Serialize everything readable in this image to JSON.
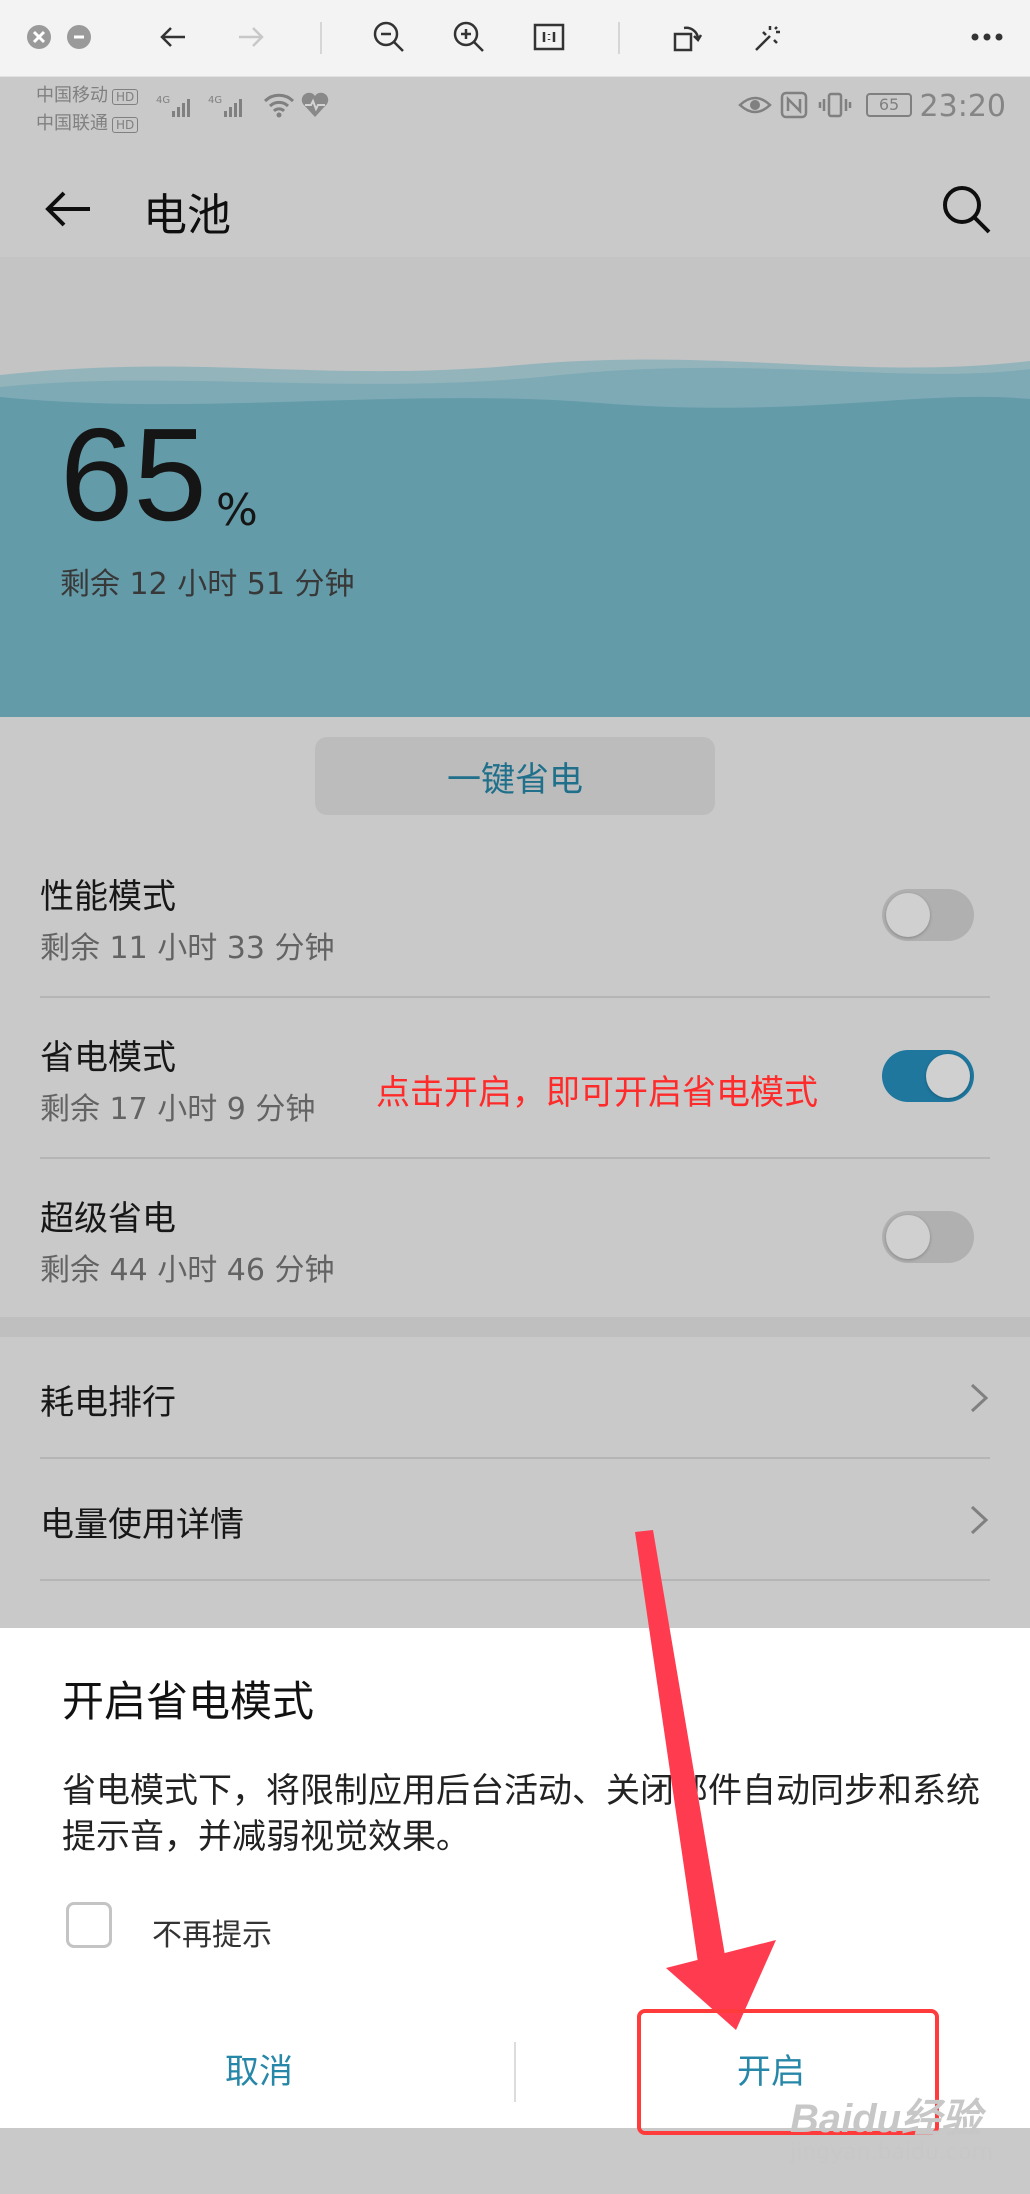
{
  "viewer": {
    "icons": [
      "close-icon",
      "minimize-icon",
      "back-arrow-icon",
      "forward-arrow-icon",
      "zoom-out-icon",
      "zoom-in-icon",
      "actual-size-icon",
      "rotate-icon",
      "magic-wand-icon",
      "more-icon"
    ]
  },
  "status_bar": {
    "carrier_1": "中国移动",
    "carrier_2": "中国联通",
    "hd_badge": "HD",
    "signal_label": "4G",
    "battery_level": "65",
    "time": "23:20"
  },
  "app_bar": {
    "title": "电池"
  },
  "battery": {
    "percent": "65",
    "percent_sign": "%",
    "remaining": "剩余 12 小时 51 分钟",
    "wave_color": "#6fb6c8"
  },
  "one_click_label": "一键省电",
  "modes": [
    {
      "title": "性能模式",
      "remaining": "剩余 11 小时 33 分钟",
      "enabled": false
    },
    {
      "title": "省电模式",
      "remaining": "剩余 17 小时 9 分钟",
      "enabled": true
    },
    {
      "title": "超级省电",
      "remaining": "剩余 44 小时 46 分钟",
      "enabled": false
    }
  ],
  "links": [
    {
      "label": "耗电排行"
    },
    {
      "label": "电量使用详情"
    }
  ],
  "dialog": {
    "title": "开启省电模式",
    "body": "省电模式下，将限制应用后台活动、关闭邮件自动同步和系统提示音，并减弱视觉效果。",
    "checkbox_label": "不再提示",
    "cancel_label": "取消",
    "confirm_label": "开启"
  },
  "annotation": {
    "text": "点击开启，即可开启省电模式",
    "color": "#ff2a2a"
  },
  "watermark": {
    "logo": "Baidu经验",
    "url": "jingyan.baidu.com"
  },
  "colors": {
    "accent": "#2787a8",
    "toggle_on": "#2690bf"
  }
}
